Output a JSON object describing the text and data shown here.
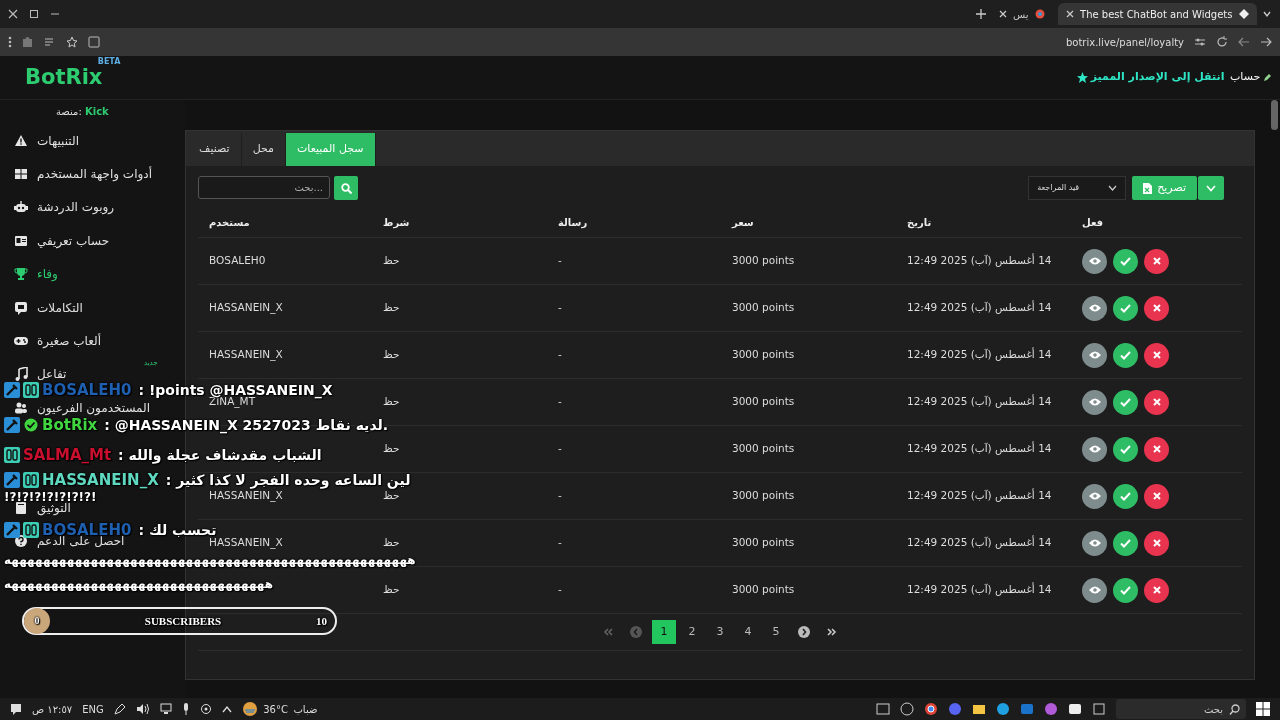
{
  "browser": {
    "tabs": [
      {
        "title": "The best ChatBot and Widgets",
        "selected": true
      },
      {
        "title": "يس",
        "selected": false
      }
    ],
    "url": "botrix.live/panel/loyalty"
  },
  "header": {
    "logo": "BotRix",
    "logo_badge": "BETA",
    "upgrade_link": "انتقل إلى الإصدار المميز",
    "account": "حساب"
  },
  "sidebar": {
    "platform_label": "منصة:",
    "platform": "Kick",
    "items": [
      {
        "label": "التنبيهات",
        "selected": false
      },
      {
        "label": "أدوات واجهة المستخدم",
        "selected": false
      },
      {
        "label": "روبوت الدردشة",
        "selected": false
      },
      {
        "label": "حساب تعريفي",
        "selected": false
      },
      {
        "label": "وفاء",
        "selected": true
      },
      {
        "label": "التكاملات",
        "selected": false
      },
      {
        "label": "ألعاب صغيرة",
        "selected": false
      },
      {
        "label": "تفاعل",
        "selected": false,
        "badge": "جديد"
      },
      {
        "label": "المستخدمون الفرعيون",
        "selected": false
      },
      {
        "label": "التوثيق",
        "selected": false
      },
      {
        "label": "احصل على الدعم",
        "selected": false
      }
    ]
  },
  "tabs": [
    {
      "label": "سجل المبيعات",
      "selected": true
    },
    {
      "label": "محل",
      "selected": false
    },
    {
      "label": "تصنيف",
      "selected": false
    }
  ],
  "search": {
    "placeholder": "...بحث"
  },
  "status_filter": {
    "value": "قيد المراجعة"
  },
  "export_button": "تصريح",
  "table": {
    "columns": [
      "فعل",
      "تاريخ",
      "سعر",
      "رسالة",
      "شرط",
      "مستخدم"
    ],
    "rows": [
      {
        "user": "BOSALEH0",
        "condition": "حظ",
        "message": "-",
        "price": "3000 points",
        "date": "14 أغسطس (آب) 2025 12:49"
      },
      {
        "user": "HASSANEIN_X",
        "condition": "حظ",
        "message": "-",
        "price": "3000 points",
        "date": "14 أغسطس (آب) 2025 12:49"
      },
      {
        "user": "HASSANEIN_X",
        "condition": "حظ",
        "message": "-",
        "price": "3000 points",
        "date": "14 أغسطس (آب) 2025 12:49"
      },
      {
        "user": "ZINA_MT",
        "condition": "حظ",
        "message": "-",
        "price": "3000 points",
        "date": "14 أغسطس (آب) 2025 12:49"
      },
      {
        "condition": "حظ",
        "message": "-",
        "price": "3000 points",
        "date": "14 أغسطس (آب) 2025 12:49"
      },
      {
        "user": "HASSANEIN_X",
        "condition": "حظ",
        "message": "-",
        "price": "3000 points",
        "date": "14 أغسطس (آب) 2025 12:49"
      },
      {
        "user": "HASSANEIN_X",
        "condition": "حظ",
        "message": "-",
        "price": "3000 points",
        "date": "14 أغسطس (آب) 2025 12:49"
      },
      {
        "condition": "حظ",
        "message": "-",
        "price": "3000 points",
        "date": "14 أغسطس (آب) 2025 12:49"
      }
    ]
  },
  "pagination": {
    "pages": [
      {
        "label": "5",
        "selected": false
      },
      {
        "label": "4",
        "selected": false
      },
      {
        "label": "3",
        "selected": false
      },
      {
        "label": "2",
        "selected": false
      },
      {
        "label": "1",
        "selected": true
      }
    ]
  },
  "chat_overlay": {
    "messages": [
      {
        "user": "BOSALEH0",
        "color": "#1f5fb0",
        "text": ": !points @HASSANEIN_X"
      },
      {
        "user": "BotRix",
        "color": "#3fd63f",
        "text": ": @HASSANEIN_X 2527023 لديه نقاط."
      },
      {
        "user": "SALMA_Mt",
        "color": "#c8102e",
        "text": ": الشباب مقدشاف عجلة والله"
      },
      {
        "user": "HASSANEIN_X",
        "color": "#5fd8c0",
        "text": ": لين الساعه وحده الفجر لا كذا كثير",
        "extra_lines": [
          "!?!?!?!?!?!?!?!"
        ]
      },
      {
        "user": "BOSALEH0",
        "color": "#1f5fb0",
        "text": ": تحسب لك",
        "extra_lines": [
          "هههههههههههههههههههههههههههههههههههههههههههههههههههه",
          "هههههههههههههههههههههههههههههههههه"
        ]
      }
    ],
    "goal": {
      "current": "0",
      "label": "SUBSCRIBERS",
      "target": "10"
    }
  },
  "taskbar": {
    "search_placeholder": "بحث",
    "weather_temp": "36°C",
    "weather_text": "ضباب",
    "language": "ENG",
    "time": "١٢:٥٧ ص"
  }
}
